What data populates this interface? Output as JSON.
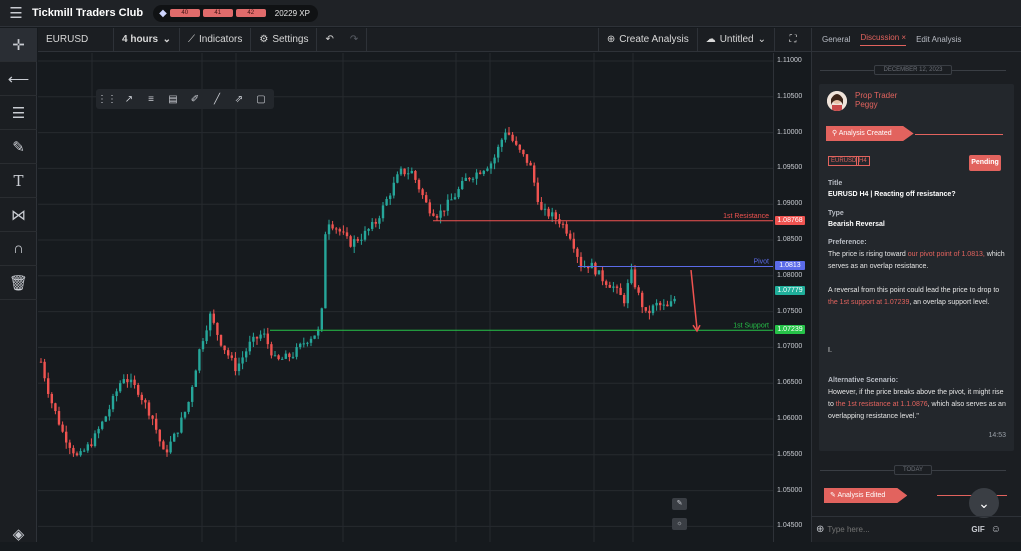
{
  "app": {
    "title": "Tickmill Traders Club",
    "levels": [
      "40",
      "41",
      "42"
    ],
    "xp": "20229 XP"
  },
  "toolbar": {
    "symbol": "EURUSD",
    "interval": "4 hours",
    "indicators": "Indicators",
    "settings": "Settings",
    "create_analysis": "Create Analysis",
    "doc_name": "Untitled"
  },
  "chart": {
    "price_ticks": [
      "1.11000",
      "1.10500",
      "1.10000",
      "1.09500",
      "1.09000",
      "1.08500",
      "1.08000",
      "1.07500",
      "1.07000",
      "1.06500",
      "1.06000",
      "1.05500",
      "1.05000",
      "1.04500"
    ],
    "levels": [
      {
        "label": "1st Resistance",
        "price": "1.08768",
        "color": "#ef5350"
      },
      {
        "label": "Pivot",
        "price": "1.0813",
        "color": "#5b6be8"
      },
      {
        "label": "1st Support",
        "price": "1.07239",
        "color": "#26c248"
      }
    ],
    "current_price": "1.07779",
    "colors": {
      "up": "#26a69a",
      "down": "#ef5350"
    }
  },
  "panel": {
    "tabs": [
      "General",
      "Discussion",
      "Edit Analysis"
    ],
    "date1": "DECEMBER 12, 2023",
    "author_role": "Prop Trader",
    "author_name": "Peggy",
    "ribbon1": "Analysis Created",
    "tags": [
      "EURUSD",
      "H4"
    ],
    "status": "Pending",
    "title_label": "Title",
    "title": "EURUSD H4 | Reacting off resistance?",
    "type_label": "Type",
    "type": "Bearish Reversal",
    "pref_label": "Preference:",
    "pref_1": "The price is rising toward ",
    "pref_hl1": "our pivot point of 1.0813,",
    "pref_2": " which serves as an overlap resistance.",
    "pref_3": "A reversal from this point could lead the price to drop to ",
    "pref_hl2": "the 1st support at 1.07239",
    "pref_4": ", an overlap support level.",
    "pref_5": "I.",
    "alt_label": "Alternative Scenario:",
    "alt_1": "However, if the price breaks above the pivot, it might rise to ",
    "alt_hl": "the 1st resistance at 1.1.0876",
    "alt_2": ", which also serves as an overlapping resistance level.\"",
    "time": "14:53",
    "date2": "TODAY",
    "ribbon2": "Analysis Edited",
    "composer_placeholder": "Type here...",
    "gif": "GIF"
  }
}
